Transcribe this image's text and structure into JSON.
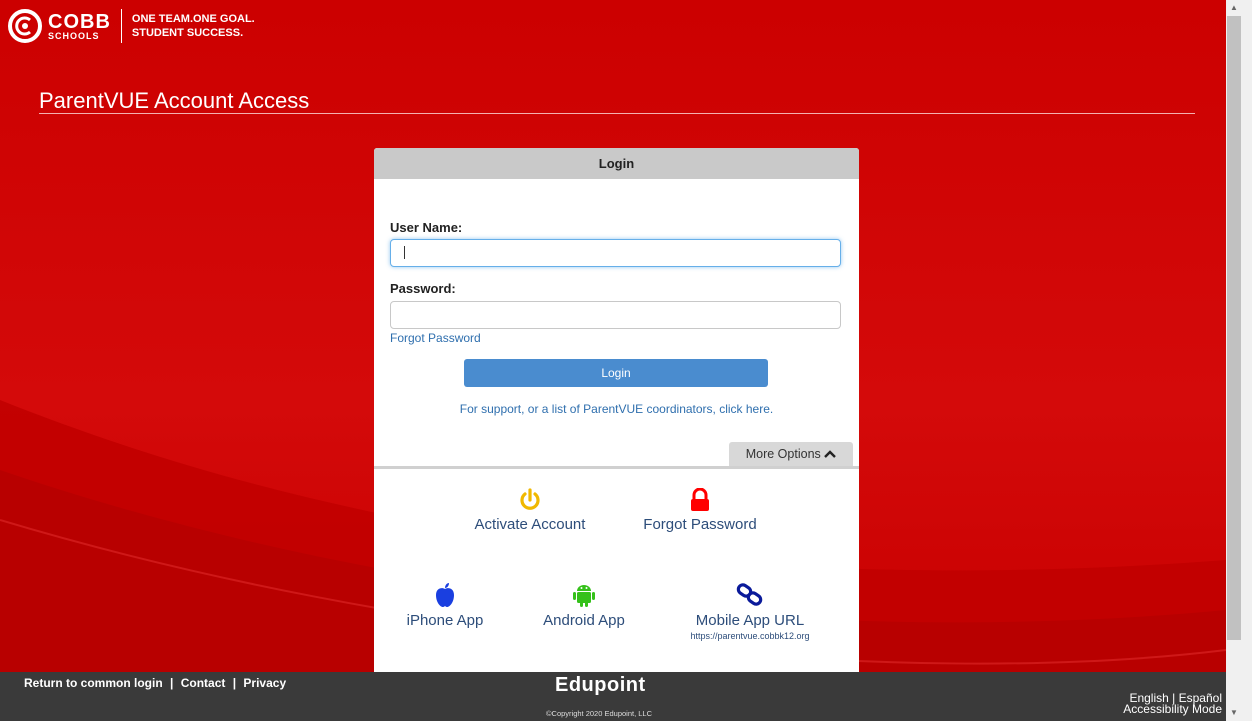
{
  "brand": {
    "name": "COBB",
    "sub": "SCHOOLS",
    "tagline_1": "ONE TEAM.ONE GOAL.",
    "tagline_2": "STUDENT SUCCESS."
  },
  "page": {
    "title": "ParentVUE Account Access"
  },
  "login": {
    "header": "Login",
    "username_label": "User Name:",
    "username_value": "",
    "password_label": "Password:",
    "password_value": "",
    "forgot_password_link": "Forgot Password",
    "login_button": "Login",
    "support_link": "For support, or a list of ParentVUE coordinators, click here.",
    "more_options": "More Options"
  },
  "options": {
    "activate_account": "Activate Account",
    "forgot_password": "Forgot Password",
    "iphone_app": "iPhone App",
    "android_app": "Android App",
    "mobile_url": "Mobile App URL",
    "mobile_url_value": "https://parentvue.cobbk12.org"
  },
  "footer": {
    "return_link": "Return to common login",
    "contact_link": "Contact",
    "privacy_link": "Privacy",
    "sep": "|",
    "edupoint": "Edupoint",
    "copyright": "©Copyright 2020 Edupoint, LLC",
    "english": "English",
    "espanol": "Español",
    "accessibility": "Accessibility Mode"
  },
  "colors": {
    "background": "#cc0000",
    "accent_blue": "#4a8ccf",
    "link": "#2f6fae",
    "activate_icon": "#f0b800",
    "lock_icon": "#ff0000",
    "apple_icon": "#1a3fe0",
    "android_icon": "#35c11a"
  },
  "icons": [
    "cobb-logo-icon",
    "power-icon",
    "lock-icon",
    "apple-icon",
    "android-icon",
    "link-icon",
    "chevron-up-icon"
  ]
}
